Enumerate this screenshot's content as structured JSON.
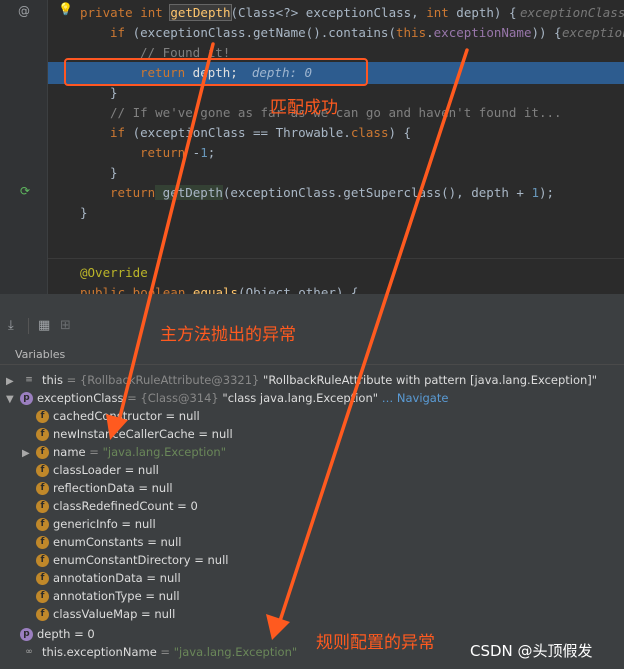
{
  "editor": {
    "hint_line1": "exceptionClass",
    "hint_line2": "exception",
    "inline_debug_value": "depth: 0",
    "lines": {
      "l1_mod": "private int ",
      "l1_fn": "getDepth",
      "l1_rest": "(Class<?> exceptionClass, ",
      "l1_int": "int",
      "l1_end": " depth) {",
      "l2_if": "if",
      "l2_a": " (exceptionClass.getName().contains(",
      "l2_this": "this",
      "l2_dot": ".",
      "l2_field": "exceptionName",
      "l2_end": ")) {",
      "l3_comment": "// Found it!",
      "l4_return": "return",
      "l4_rest": " depth;",
      "l5_brace": "}",
      "l6_comment": "// If we've gone as far as we can go and haven't found it...",
      "l7_if": "if",
      "l7_a": " (exceptionClass == Throwable.",
      "l7_class": "class",
      "l7_end": ") {",
      "l8_return": "return",
      "l8_minus": " -",
      "l8_num": "1",
      "l8_semi": ";",
      "l9_brace": "}",
      "l10_return": "return",
      "l10_fn": " getDepth",
      "l10_a": "(exceptionClass.getSuperclass(), depth + ",
      "l10_num": "1",
      "l10_end": ");",
      "l11_brace": "}",
      "l12_ann": "@Override",
      "l13_mod": "public boolean ",
      "l13_fn": "equals",
      "l13_rest": "(Object other) {"
    }
  },
  "debugger": {
    "panel_title": "Variables",
    "rows": [
      {
        "name": "this",
        "meta": " = {RollbackRuleAttribute@3321} ",
        "value": "\"RollbackRuleAttribute with pattern [java.lang.Exception]\""
      },
      {
        "name": "exceptionClass",
        "meta": " = {Class@314} ",
        "value": "\"class java.lang.Exception\"",
        "link": "… Navigate"
      },
      {
        "name": "cachedConstructor",
        "meta": " = null"
      },
      {
        "name": "newInstanceCallerCache",
        "meta": " = null"
      },
      {
        "name": "name",
        "meta": " = ",
        "value": "\"java.lang.Exception\""
      },
      {
        "name": "classLoader",
        "meta": " = null"
      },
      {
        "name": "reflectionData",
        "meta": " = null"
      },
      {
        "name": "classRedefinedCount",
        "meta": " = 0"
      },
      {
        "name": "genericInfo",
        "meta": " = null"
      },
      {
        "name": "enumConstants",
        "meta": " = null"
      },
      {
        "name": "enumConstantDirectory",
        "meta": " = null"
      },
      {
        "name": "annotationData",
        "meta": " = null"
      },
      {
        "name": "annotationType",
        "meta": " = null"
      },
      {
        "name": "classValueMap",
        "meta": " = null"
      },
      {
        "name": "depth",
        "meta": " = 0"
      },
      {
        "name": "this.exceptionName",
        "meta": " = ",
        "value": "\"java.lang.Exception\""
      }
    ]
  },
  "annotations": {
    "match_success": "匹配成功",
    "main_method_exception": "主方法抛出的异常",
    "configured_exception": "规则配置的异常"
  },
  "watermark": "CSDN @头顶假发",
  "colors": {
    "annotation": "#ff5a1f",
    "highlight": "#2d5c8f"
  }
}
